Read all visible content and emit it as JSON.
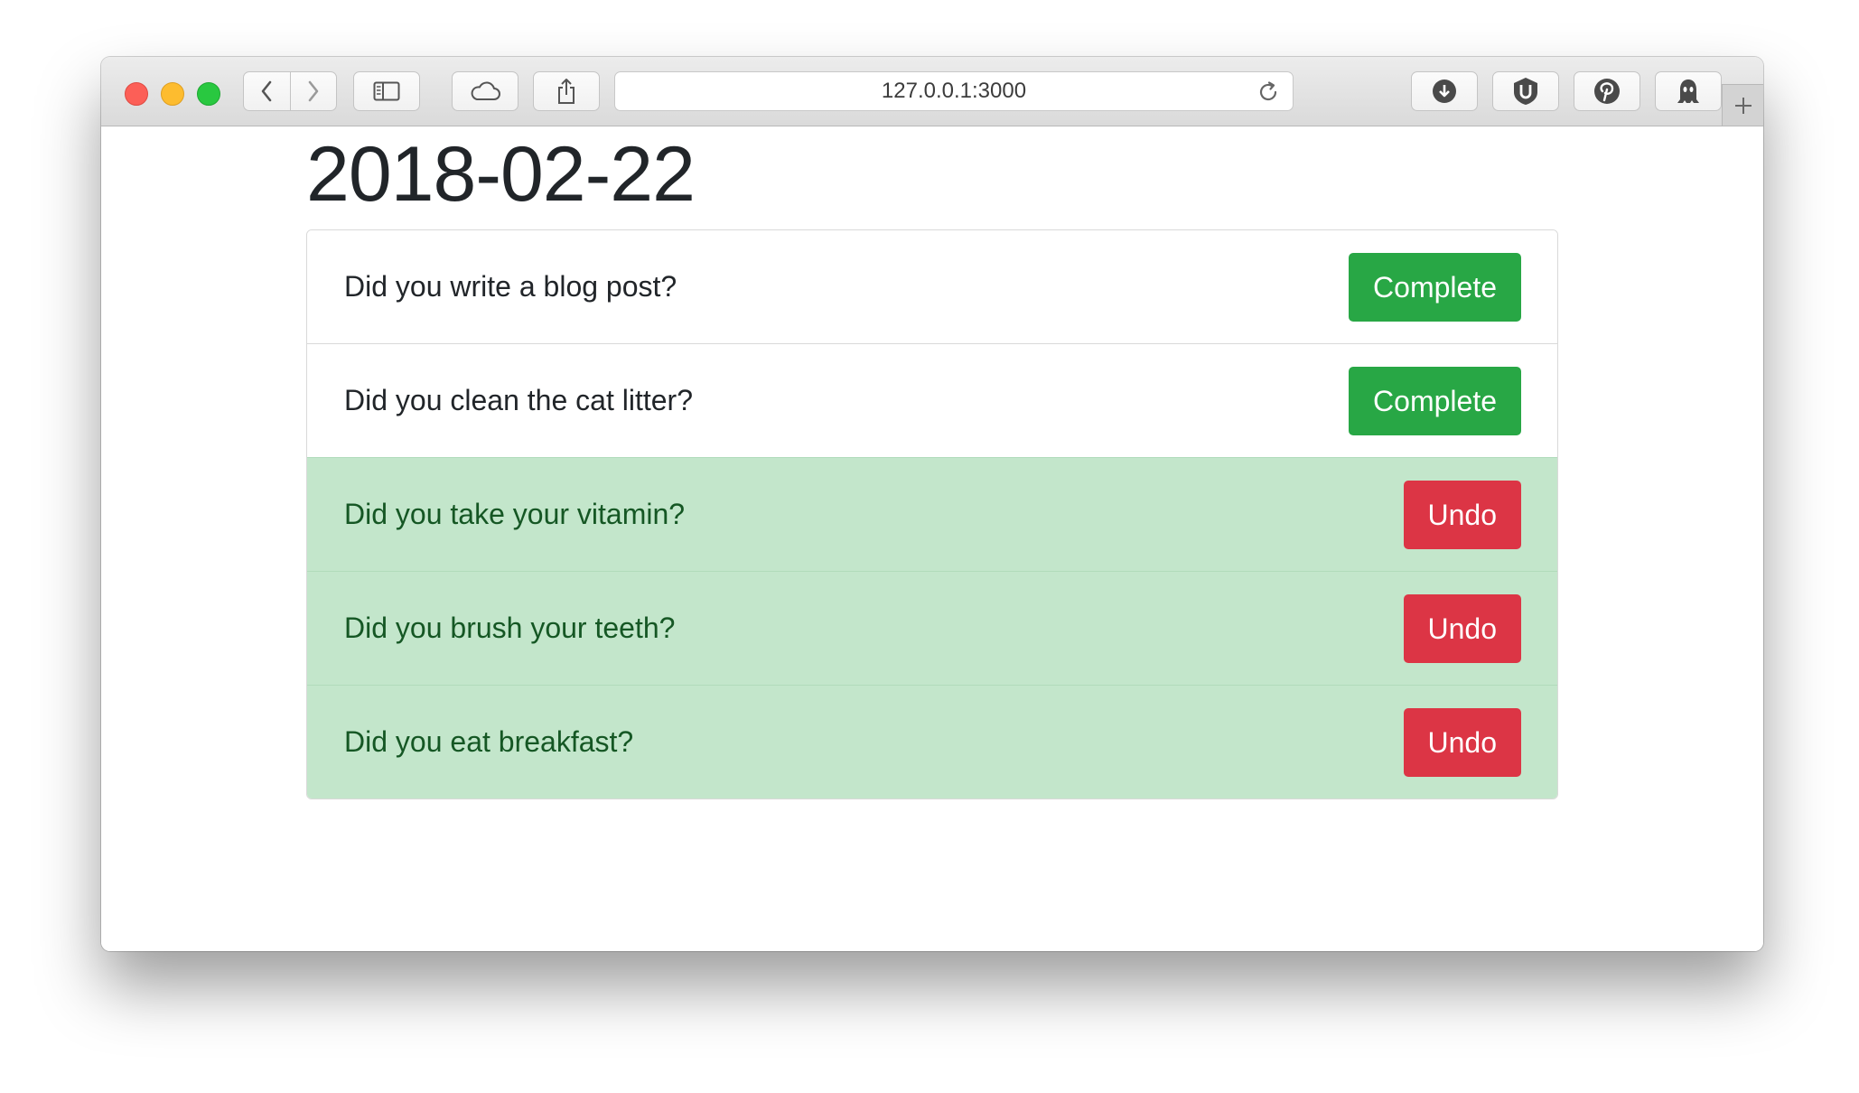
{
  "browser": {
    "address": "127.0.0.1:3000",
    "toolbar_icons": [
      "back-icon",
      "forward-icon",
      "sidebar-icon",
      "cloud-icon",
      "share-icon",
      "reload-icon",
      "download-icon",
      "ublock-icon",
      "pinterest-icon",
      "ghostery-icon",
      "new-tab-icon"
    ]
  },
  "page": {
    "date": "2018-02-22"
  },
  "tasks": [
    {
      "question": "Did you write a blog post?",
      "action": "Complete",
      "done": false
    },
    {
      "question": "Did you clean the cat litter?",
      "action": "Complete",
      "done": false
    },
    {
      "question": "Did you take your vitamin?",
      "action": "Undo",
      "done": true
    },
    {
      "question": "Did you brush your teeth?",
      "action": "Undo",
      "done": true
    },
    {
      "question": "Did you eat breakfast?",
      "action": "Undo",
      "done": true
    }
  ],
  "colors": {
    "complete": "#28a745",
    "undo": "#dc3545",
    "done_row": "#c3e6cb",
    "done_text": "#155724"
  }
}
